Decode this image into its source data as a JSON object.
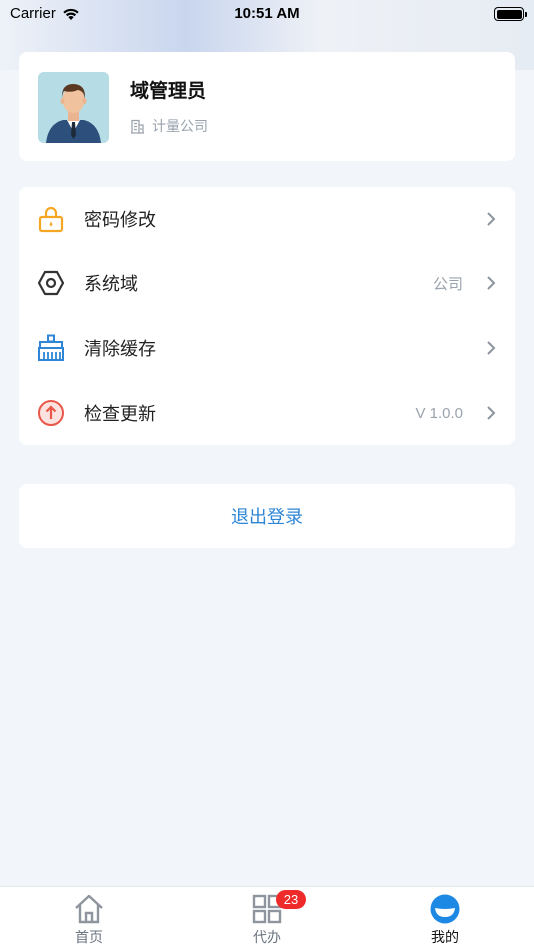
{
  "status_bar": {
    "carrier": "Carrier",
    "time": "10:51 AM"
  },
  "profile": {
    "name": "域管理员",
    "company": "计量公司"
  },
  "menu": {
    "items": [
      {
        "label": "密码修改",
        "value": "",
        "icon": "lock-icon",
        "color": "#f5a623"
      },
      {
        "label": "系统域",
        "value": "公司",
        "icon": "hexagon-nut-icon",
        "color": "#333333"
      },
      {
        "label": "清除缓存",
        "value": "",
        "icon": "broom-icon",
        "color": "#2f86d6"
      },
      {
        "label": "检查更新",
        "value": "V 1.0.0",
        "icon": "upgrade-arrow-icon",
        "color": "#e8574a"
      }
    ]
  },
  "logout": {
    "label": "退出登录",
    "color": "#2f86d6"
  },
  "tabbar": {
    "tabs": [
      {
        "label": "首页",
        "icon": "home-icon"
      },
      {
        "label": "代办",
        "icon": "grid-icon",
        "badge": "23"
      },
      {
        "label": "我的",
        "icon": "profile-icon"
      }
    ],
    "active_index": 2
  }
}
